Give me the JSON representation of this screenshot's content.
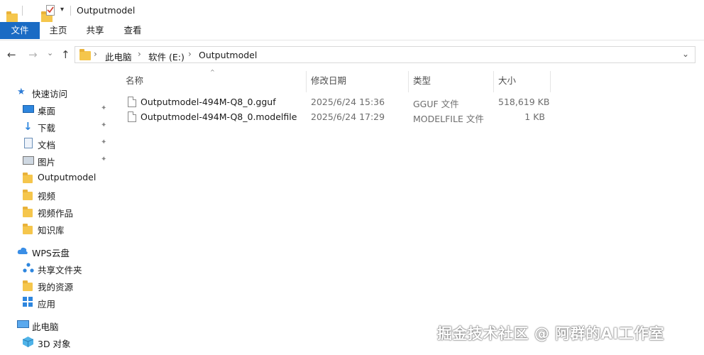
{
  "window": {
    "title": "Outputmodel"
  },
  "ribbon": {
    "tabs": [
      {
        "label": "文件"
      },
      {
        "label": "主页"
      },
      {
        "label": "共享"
      },
      {
        "label": "查看"
      }
    ]
  },
  "nav": {
    "back": "←",
    "forward": "→",
    "recent": "⌄",
    "up": "↑"
  },
  "address": {
    "crumbs": [
      {
        "label": "此电脑"
      },
      {
        "label": "软件 (E:)"
      },
      {
        "label": "Outputmodel"
      }
    ],
    "separator": "›",
    "dropdown": "⌄"
  },
  "sidebar": {
    "items": [
      {
        "label": "快速访问",
        "icon": "star-icon",
        "pinned": false
      },
      {
        "label": "桌面",
        "icon": "desktop-icon",
        "pinned": true
      },
      {
        "label": "下载",
        "icon": "download-icon",
        "pinned": true
      },
      {
        "label": "文档",
        "icon": "document-icon",
        "pinned": true
      },
      {
        "label": "图片",
        "icon": "picture-icon",
        "pinned": true
      },
      {
        "label": "Outputmodel",
        "icon": "folder-icon",
        "pinned": false
      },
      {
        "label": "视频",
        "icon": "folder-icon",
        "pinned": false
      },
      {
        "label": "视频作品",
        "icon": "folder-icon",
        "pinned": false
      },
      {
        "label": "知识库",
        "icon": "folder-icon",
        "pinned": false
      },
      {
        "label": "WPS云盘",
        "icon": "cloud-icon",
        "pinned": false
      },
      {
        "label": "共享文件夹",
        "icon": "share-icon",
        "pinned": false
      },
      {
        "label": "我的资源",
        "icon": "folder-icon",
        "pinned": false
      },
      {
        "label": "应用",
        "icon": "apps-icon",
        "pinned": false
      },
      {
        "label": "此电脑",
        "icon": "computer-icon",
        "pinned": false
      },
      {
        "label": "3D 对象",
        "icon": "cube-icon",
        "pinned": false
      }
    ],
    "pin_glyph": "📌"
  },
  "files": {
    "columns": [
      {
        "label": "名称"
      },
      {
        "label": "修改日期"
      },
      {
        "label": "类型"
      },
      {
        "label": "大小"
      }
    ],
    "sort_indicator": "^",
    "rows": [
      {
        "name": "Outputmodel-494M-Q8_0.gguf",
        "date": "2025/6/24 15:36",
        "type": "GGUF 文件",
        "size": "518,619 KB"
      },
      {
        "name": "Outputmodel-494M-Q8_0.modelfile",
        "date": "2025/6/24 17:29",
        "type": "MODELFILE 文件",
        "size": "1 KB"
      }
    ]
  },
  "watermark": "掘金技术社区 @ 阿群的AI工作室",
  "colors": {
    "accent": "#1a6bc4",
    "folder": "#f5c64c"
  }
}
